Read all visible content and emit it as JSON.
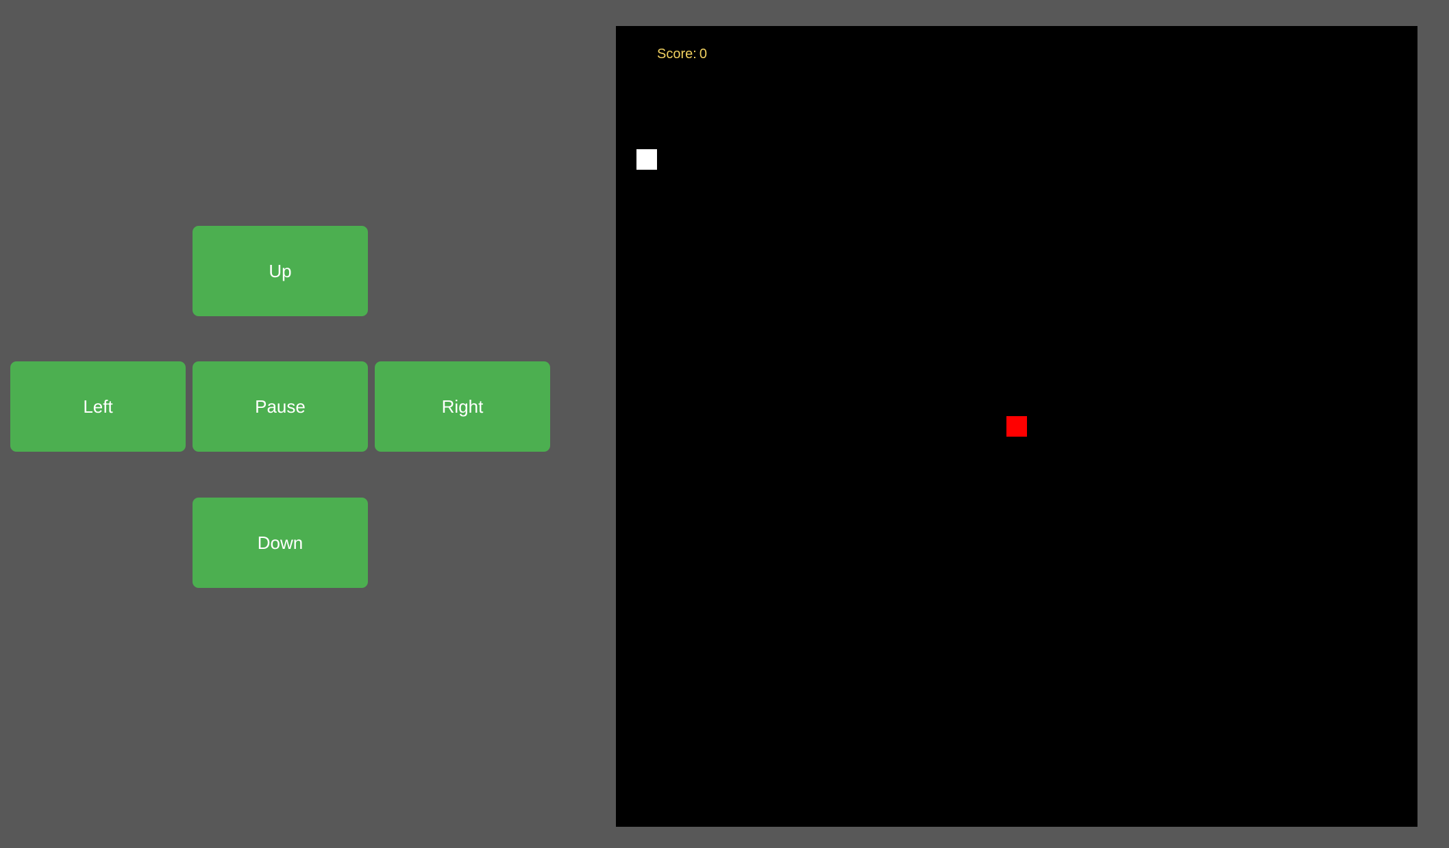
{
  "controls": {
    "up_label": "Up",
    "left_label": "Left",
    "pause_label": "Pause",
    "right_label": "Right",
    "down_label": "Down"
  },
  "game": {
    "score_label": "Score:",
    "score_value": "0",
    "colors": {
      "page_background": "#585858",
      "button": "#4caf50",
      "board": "#000000",
      "score_text": "#f0d060",
      "snake": "#ffffff",
      "food": "#ff0000"
    }
  }
}
